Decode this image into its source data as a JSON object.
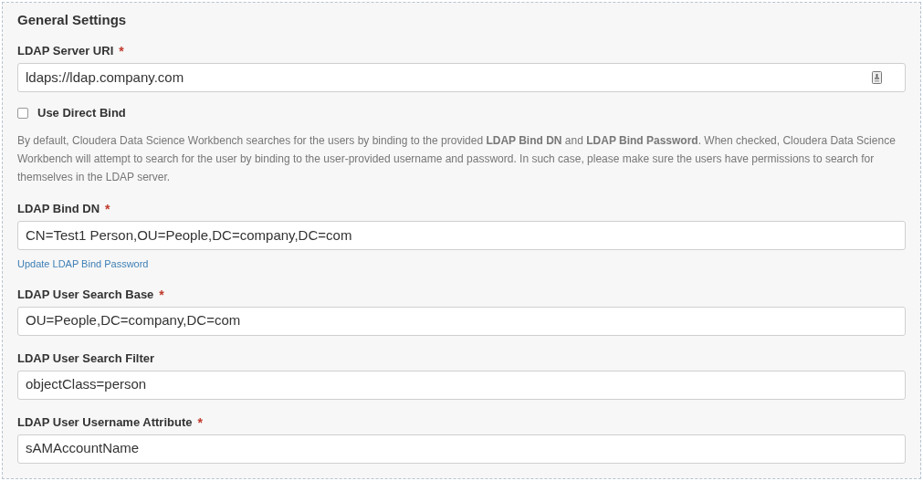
{
  "section": {
    "title": "General Settings"
  },
  "items": [
    {
      "kind": "field",
      "label": "LDAP Server URI",
      "required_mark": "*",
      "value": "ldaps://ldap.company.com",
      "contact_icon": true
    },
    {
      "kind": "checkbox",
      "label": "Use Direct Bind",
      "checked": false
    },
    {
      "kind": "help",
      "text": "By default, Cloudera Data Science Workbench searches for the users by binding to the provided **LDAP Bind DN** and **LDAP Bind Password**. When checked, Cloudera Data Science Workbench will attempt to search for the user by binding to the user-provided username and password. In such case, please make sure the users have permissions to search for themselves in the LDAP server."
    },
    {
      "kind": "field",
      "label": "LDAP Bind DN",
      "required_mark": "*",
      "value": "CN=Test1 Person,OU=People,DC=company,DC=com"
    },
    {
      "kind": "link",
      "text": "Update LDAP Bind Password"
    },
    {
      "kind": "field",
      "label": "LDAP User Search Base",
      "required_mark": "*",
      "value": "OU=People,DC=company,DC=com"
    },
    {
      "kind": "field",
      "label": "LDAP User Search Filter",
      "value": "objectClass=person"
    },
    {
      "kind": "field",
      "label": "LDAP User Username Attribute",
      "required_mark": "*",
      "value": "sAMAccountName"
    }
  ]
}
